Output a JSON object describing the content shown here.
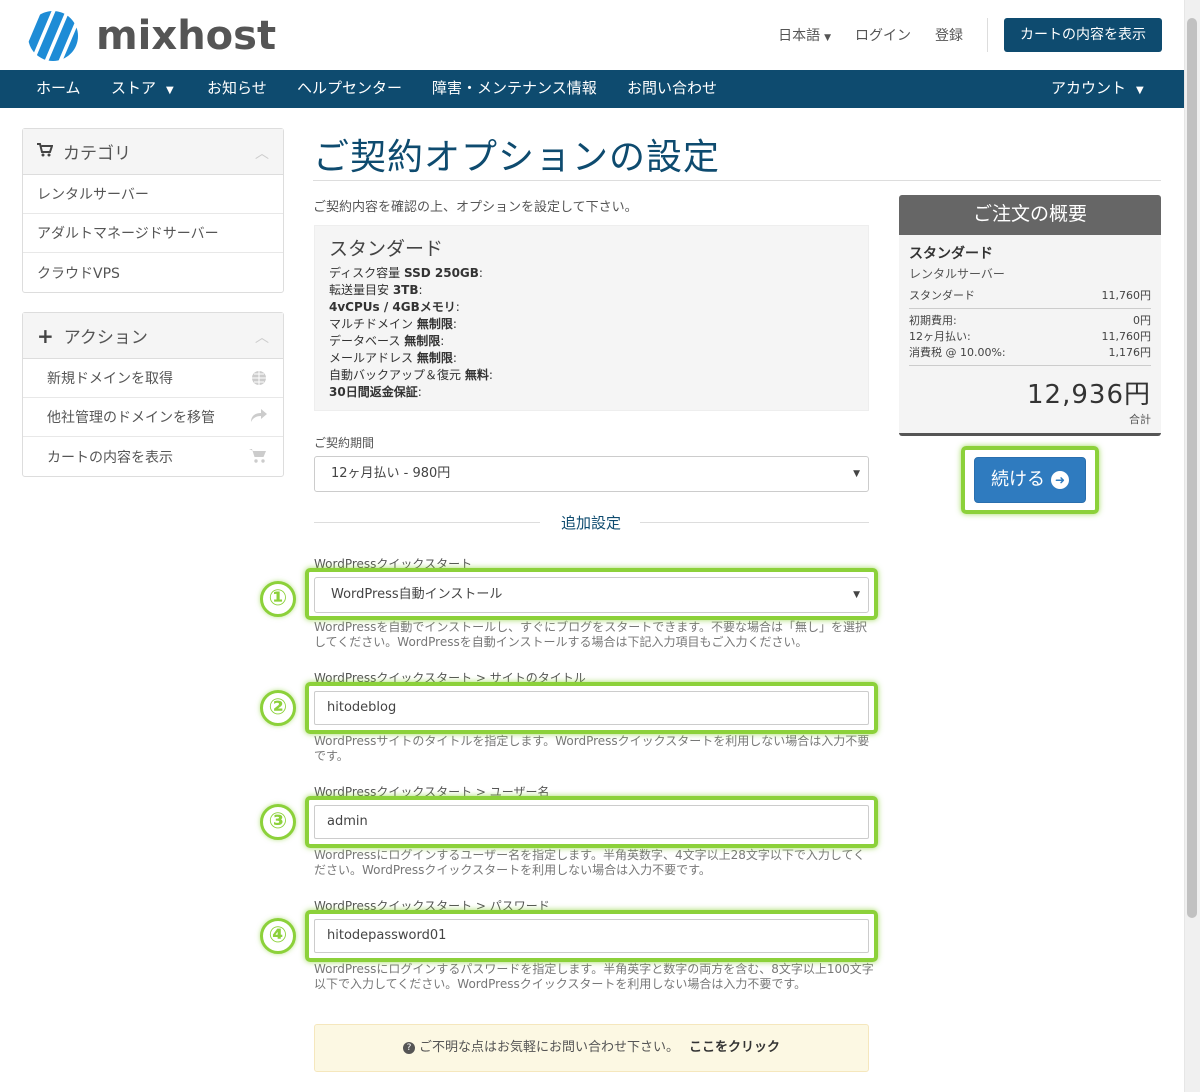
{
  "header": {
    "logo_text": "mixhost",
    "language": "日本語",
    "login": "ログイン",
    "register": "登録",
    "cart_button": "カートの内容を表示"
  },
  "nav": {
    "items": [
      "ホーム",
      "ストア",
      "お知らせ",
      "ヘルプセンター",
      "障害・メンテナンス情報",
      "お問い合わせ"
    ],
    "account": "アカウント"
  },
  "sidebar": {
    "categories": {
      "title": "カテゴリ",
      "items": [
        "レンタルサーバー",
        "アダルトマネージドサーバー",
        "クラウドVPS"
      ]
    },
    "actions": {
      "title": "アクション",
      "items": [
        "新規ドメインを取得",
        "他社管理のドメインを移管",
        "カートの内容を表示"
      ]
    }
  },
  "main": {
    "title": "ご契約オプションの設定",
    "intro": "ご契約内容を確認の上、オプションを設定して下さい。",
    "plan": {
      "name": "スタンダード",
      "specs": [
        {
          "label": "ディスク容量 ",
          "value": "SSD 250GB",
          "suffix": ":"
        },
        {
          "label": "転送量目安 ",
          "value": "3TB",
          "suffix": ":"
        },
        {
          "label": "",
          "value": "4vCPUs / 4GBメモリ",
          "suffix": ":"
        },
        {
          "label": "マルチドメイン ",
          "value": "無制限",
          "suffix": ":"
        },
        {
          "label": "データベース ",
          "value": "無制限",
          "suffix": ":"
        },
        {
          "label": "メールアドレス ",
          "value": "無制限",
          "suffix": ":"
        },
        {
          "label": "自動バックアップ＆復元 ",
          "value": "無料",
          "suffix": ":"
        },
        {
          "label": "",
          "value": "30日間返金保証",
          "suffix": ":"
        }
      ]
    },
    "billing_label": "ご契約期間",
    "billing_value": "12ヶ月払い - 980円",
    "additional_settings": "追加設定",
    "wp_quickstart": {
      "label": "WordPressクイックスタート",
      "value": "WordPress自動インストール",
      "help": "WordPressを自動でインストールし、すぐにブログをスタートできます。不要な場合は「無し」を選択してください。WordPressを自動インストールする場合は下記入力項目もご入力ください。"
    },
    "site_title": {
      "label": "WordPressクイックスタート > サイトのタイトル",
      "value": "hitodeblog",
      "help": "WordPressサイトのタイトルを指定します。WordPressクイックスタートを利用しない場合は入力不要です。"
    },
    "username": {
      "label": "WordPressクイックスタート > ユーザー名",
      "value": "admin",
      "help": "WordPressにログインするユーザー名を指定します。半角英数字、4文字以上28文字以下で入力してください。WordPressクイックスタートを利用しない場合は入力不要です。"
    },
    "password": {
      "label": "WordPressクイックスタート > パスワード",
      "value": "hitodepassword01",
      "help": "WordPressにログインするパスワードを指定します。半角英字と数字の両方を含む、8文字以上100文字以下で入力してください。WordPressクイックスタートを利用しない場合は入力不要です。"
    },
    "notice_text": "ご不明な点はお気軽にお問い合わせ下さい。",
    "notice_link": "ここをクリック",
    "annotations": [
      "①",
      "②",
      "③",
      "④"
    ]
  },
  "summary": {
    "title": "ご注文の概要",
    "plan": "スタンダード",
    "category": "レンタルサーバー",
    "line_label": "スタンダード",
    "line_value": "11,760円",
    "setup_label": "初期費用:",
    "setup_value": "0円",
    "monthly_label": "12ヶ月払い:",
    "monthly_value": "11,760円",
    "tax_label": "消費税 @ 10.00%:",
    "tax_value": "1,176円",
    "total": "12,936円",
    "total_label": "合計",
    "continue_button": "続ける"
  },
  "colors": {
    "brand": "#0e4b6f",
    "highlight": "#8cd13a",
    "button": "#2f7bbf"
  }
}
